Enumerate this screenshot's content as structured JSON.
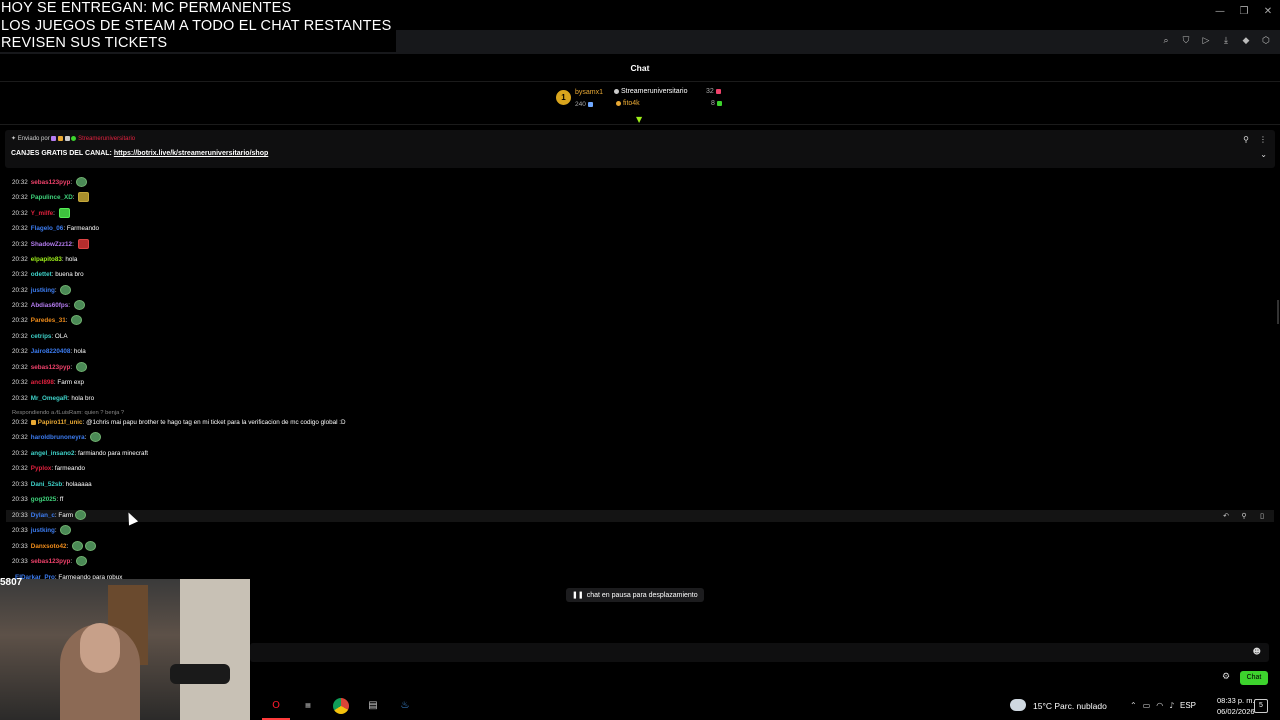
{
  "overlay": {
    "line1": "HOY SE ENTREGAN: MC PERMANENTES",
    "line2": "LOS JUEGOS DE STEAM A TODO EL CHAT RESTANTES",
    "line3": "REVISEN SUS TICKETS"
  },
  "chat": {
    "title": "Chat",
    "leaders": {
      "left_top": "bysamx1",
      "left_bottom": "240",
      "right_top_name": "Streameruniversitario",
      "right_top_count": "32",
      "right_bottom_name": "fito4k",
      "right_bottom_count": "8"
    },
    "pinned": {
      "by_label": "Enviado por",
      "by_user": "Streameruniversitario",
      "message_prefix": "CANJES GRATIS DEL CANAL:",
      "link": "https://botrix.live/k/streameruniversitario/shop"
    },
    "reply_context": "Respondiendo a ⁄tLuisRam: quien ? benja ?",
    "messages": [
      {
        "time": "20:32",
        "user": "sebas123pyp",
        "color": "#f0426b",
        "text": "",
        "emotes": [
          "round"
        ]
      },
      {
        "time": "20:32",
        "user": "Papulince_XD",
        "color": "#3ed17a",
        "text": "",
        "emotes": [
          "sq"
        ]
      },
      {
        "time": "20:32",
        "user": "Y_milfe",
        "color": "#e0213e",
        "text": "",
        "emotes": [
          "green"
        ]
      },
      {
        "time": "20:32",
        "user": "Flagelo_06",
        "color": "#3c7cf0",
        "text": "Farmeando",
        "emotes": []
      },
      {
        "time": "20:32",
        "user": "ShadowZzz12",
        "color": "#b47cf0",
        "text": "",
        "emotes": [
          "red"
        ]
      },
      {
        "time": "20:32",
        "user": "elpapito83",
        "color": "#9ef01a",
        "text": "hola",
        "emotes": []
      },
      {
        "time": "20:32",
        "user": "odettet",
        "color": "#3ed1c8",
        "text": "buena bro",
        "emotes": []
      },
      {
        "time": "20:32",
        "user": "justking",
        "color": "#3c7cf0",
        "text": "",
        "emotes": [
          "round"
        ]
      },
      {
        "time": "20:32",
        "user": "Abdias60fps",
        "color": "#b47cf0",
        "text": "",
        "emotes": [
          "round"
        ]
      },
      {
        "time": "20:32",
        "user": "Paredes_31",
        "color": "#f08c1a",
        "text": "",
        "emotes": [
          "round"
        ]
      },
      {
        "time": "20:32",
        "user": "cetrips",
        "color": "#3ed1c8",
        "text": "OLA",
        "emotes": []
      },
      {
        "time": "20:32",
        "user": "Jairo8220408",
        "color": "#3c7cf0",
        "text": "hola",
        "emotes": []
      },
      {
        "time": "20:32",
        "user": "sebas123pyp",
        "color": "#f0426b",
        "text": "",
        "emotes": [
          "round"
        ]
      },
      {
        "time": "20:32",
        "user": "ancl898",
        "color": "#e0213e",
        "text": "Farm exp",
        "emotes": []
      },
      {
        "time": "20:32",
        "user": "Mr_OmegaR",
        "color": "#3ed1c8",
        "text": "hola bro",
        "emotes": []
      },
      {
        "time": "20:32",
        "user": "Papiro11f_unic",
        "color": "#e9a934",
        "text": "@1chris mai papu brother te hago tag en mi ticket para la verificacion de mc codigo global :D",
        "emotes": []
      },
      {
        "time": "20:32",
        "user": "haroldbrunoneyra",
        "color": "#3c7cf0",
        "text": "",
        "emotes": [
          "round"
        ]
      },
      {
        "time": "20:32",
        "user": "angel_insano2",
        "color": "#3ed1c8",
        "text": "farmiando para minecraft",
        "emotes": []
      },
      {
        "time": "20:32",
        "user": "Pyplox",
        "color": "#e0213e",
        "text": "farmeando",
        "emotes": []
      },
      {
        "time": "20:33",
        "user": "Dani_52sb",
        "color": "#3ed1c8",
        "text": "holaaaaa",
        "emotes": []
      },
      {
        "time": "20:33",
        "user": "gog2025",
        "color": "#3ed17a",
        "text": "ff",
        "emotes": []
      },
      {
        "time": "20:33",
        "user": "Dylan_c",
        "color": "#3c7cf0",
        "text": "Farm",
        "emotes": [
          "round"
        ]
      },
      {
        "time": "20:33",
        "user": "justking",
        "color": "#3c7cf0",
        "text": "",
        "emotes": [
          "round"
        ]
      },
      {
        "time": "20:33",
        "user": "Danxsoto42",
        "color": "#f08c1a",
        "text": "",
        "emotes": [
          "round",
          "round"
        ]
      },
      {
        "time": "20:33",
        "user": "sebas123pyp",
        "color": "#f0426b",
        "text": "",
        "emotes": [
          "round"
        ]
      },
      {
        "time": "",
        "user": "ElDarkar_Pro",
        "color": "#3c7cf0",
        "text": "Farmeando para robux",
        "emotes": []
      }
    ],
    "paused_label": "chat en pausa para desplazamiento",
    "input_placeholder": "",
    "send_label": "Chat"
  },
  "webcam": {
    "label": "5807"
  },
  "taskbar": {
    "weather": "15°C  Parc. nublado",
    "lang": "ESP",
    "time": "08:33 p. m.",
    "date": "06/02/2026",
    "notifications": "5"
  },
  "colors": {
    "accent": "#3dd32d",
    "background": "#000000"
  },
  "icons": [
    "search-icon",
    "shield-icon",
    "play-icon",
    "download-icon",
    "pin-icon",
    "more-icon",
    "emoji-icon",
    "gear-icon"
  ]
}
